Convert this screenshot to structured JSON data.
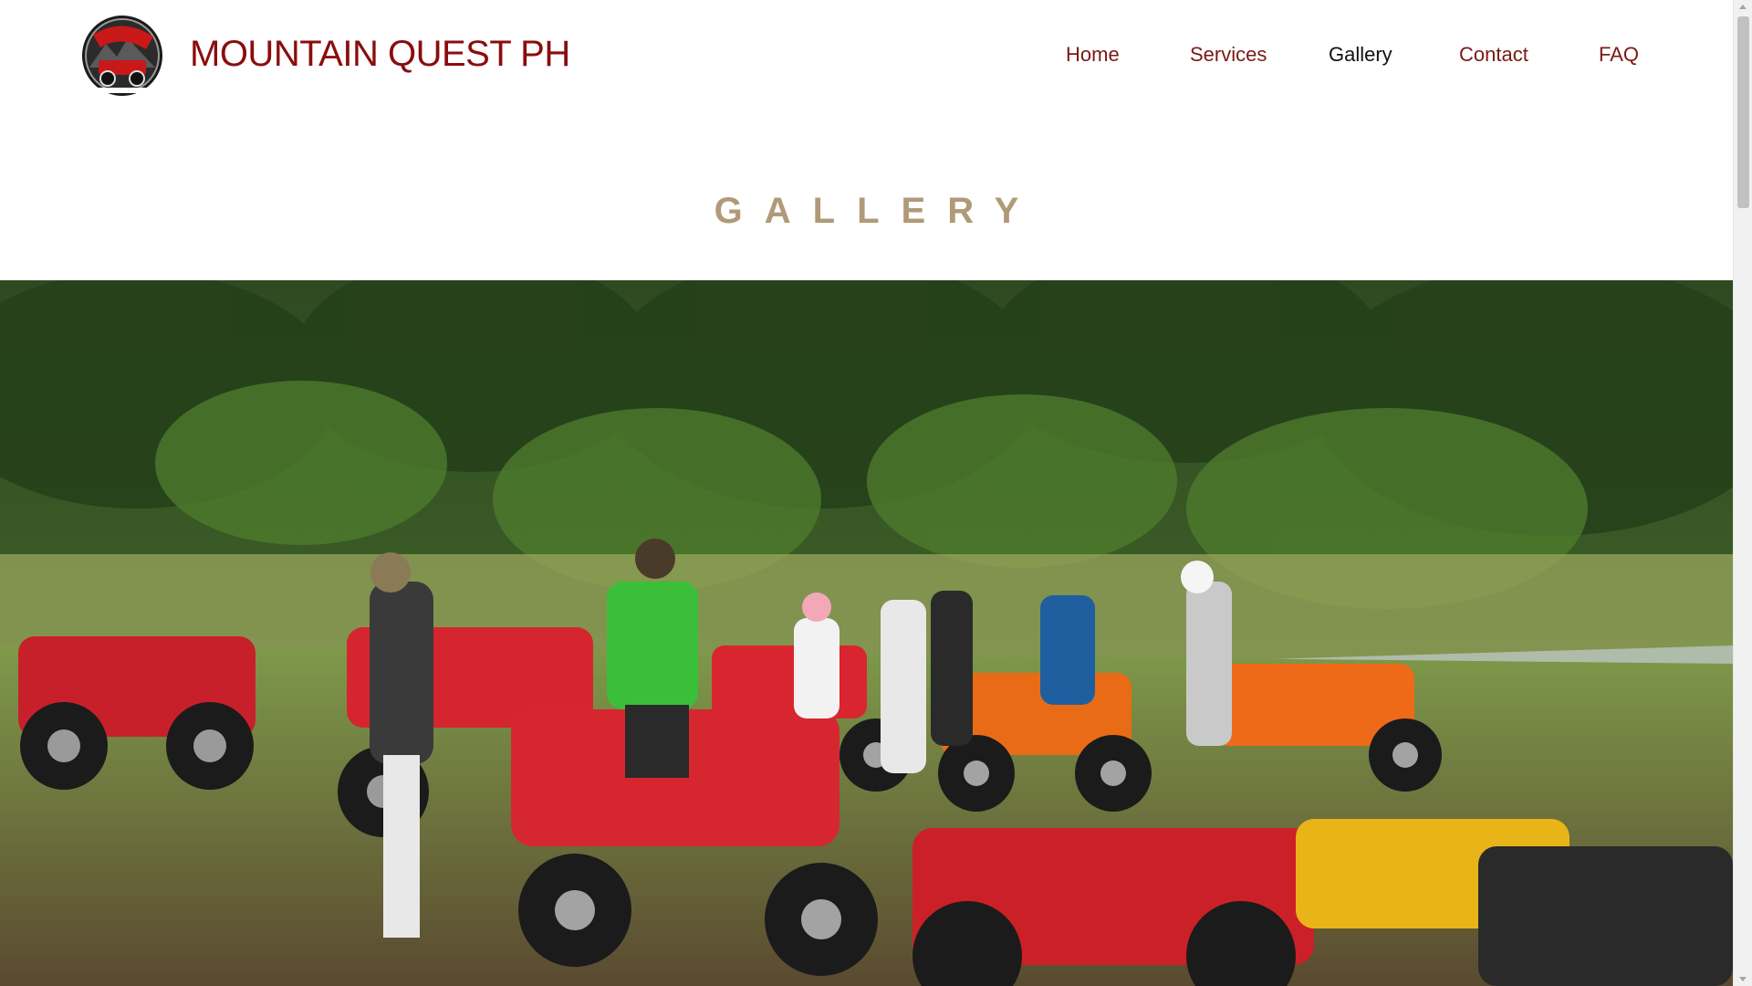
{
  "header": {
    "brand": "MOUNTAIN QUEST PH",
    "logo_icon": "mountain-quest-logo",
    "nav": [
      {
        "label": "Home"
      },
      {
        "label": "Services"
      },
      {
        "label": "Gallery"
      },
      {
        "label": "Contact"
      },
      {
        "label": "FAQ"
      }
    ]
  },
  "main": {
    "title": "GALLERY"
  },
  "colors": {
    "brand": "#8a0d0d",
    "nav_text": "#7a1a12",
    "title": "#b09a78",
    "background": "#ffffff"
  }
}
